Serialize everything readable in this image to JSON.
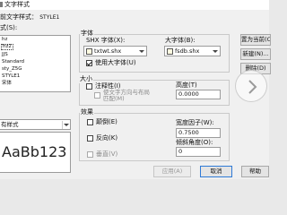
{
  "window": {
    "title": "文字样式"
  },
  "current_style": {
    "label": "前文字样式：",
    "value": "STYLE1"
  },
  "styles_label": "式(S):",
  "styles": [
    "hz",
    "hz2",
    "JJS",
    "Standard",
    "sty_Z5G",
    "STYLE1",
    "宋体"
  ],
  "selected_style_index": 1,
  "filter": {
    "value": "有样式"
  },
  "preview_text": "AaBb123",
  "font": {
    "group_label": "字体",
    "shx_label": "SHX 字体(X):",
    "shx_value": "txtwt.shx",
    "bigfont_label": "大字体(B):",
    "bigfont_value": "fsdb.shx",
    "use_bigfont_label": "使用大字体(U)",
    "use_bigfont_checked": true
  },
  "size": {
    "group_label": "大小",
    "annotative_label": "注释性(I)",
    "annotative_checked": false,
    "match_orientation_label": "使文字方向与布局",
    "match_orientation_label2": "匹配(M)",
    "match_orientation_checked": false,
    "height_label": "高度(T)",
    "height_value": "0.0000"
  },
  "effects": {
    "group_label": "效果",
    "upside_down_label": "颠倒(E)",
    "upside_down_checked": false,
    "backwards_label": "反向(K)",
    "backwards_checked": false,
    "vertical_label": "垂直(V)",
    "vertical_checked": false,
    "width_factor_label": "宽度因子(W):",
    "width_factor_value": "0.7500",
    "oblique_label": "倾斜角度(O):",
    "oblique_value": "0"
  },
  "buttons": {
    "set_current": "置为当前(C",
    "new": "新建(N)...",
    "delete": "删除(D)",
    "apply": "应用(A)",
    "cancel": "取消",
    "help": "帮助"
  }
}
